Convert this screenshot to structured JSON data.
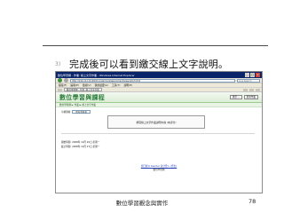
{
  "instruction": {
    "number": "3)",
    "text": "完成後可以看到繳交線上文字說明。"
  },
  "browser": {
    "title": "數位學習網 - 作業: 線上文字作業 - Windows Internet Explorer",
    "window_buttons": [
      "_",
      "□",
      "×"
    ],
    "address": "http://140.111.34.69/moodle/mod/assignment/view.php?id=6",
    "search_placeholder": "Live Search",
    "menu": [
      "檔案(F)",
      "編輯(E)",
      "檢視(V)",
      "我的最愛(A)",
      "工具(T)",
      "說明(H)"
    ],
    "tab_label": "數位學習網 - 作業: 線上文字作業"
  },
  "site": {
    "logo": "數位學習與課程",
    "buttons": [
      "跳至...",
      "更新作業"
    ],
    "breadcrumb": "數位學習網 ► 作業 ► 線上文字作業",
    "user_label": "可視群組",
    "user_select": "所有參與者",
    "submission_text": "撰寫線上文字作業說明內容 (未評分)",
    "info_row_1": "開始時間: 2008年 10月 20日 星期一",
    "info_row_2": "截止時間: 2008年 10月 27日 星期一",
    "footer_link": "您已經以 teacher 身分登入 (登出)",
    "footer_line": "數位學習網"
  },
  "slide": {
    "caption": "數位學習觀念與實作",
    "page_number": "78"
  }
}
